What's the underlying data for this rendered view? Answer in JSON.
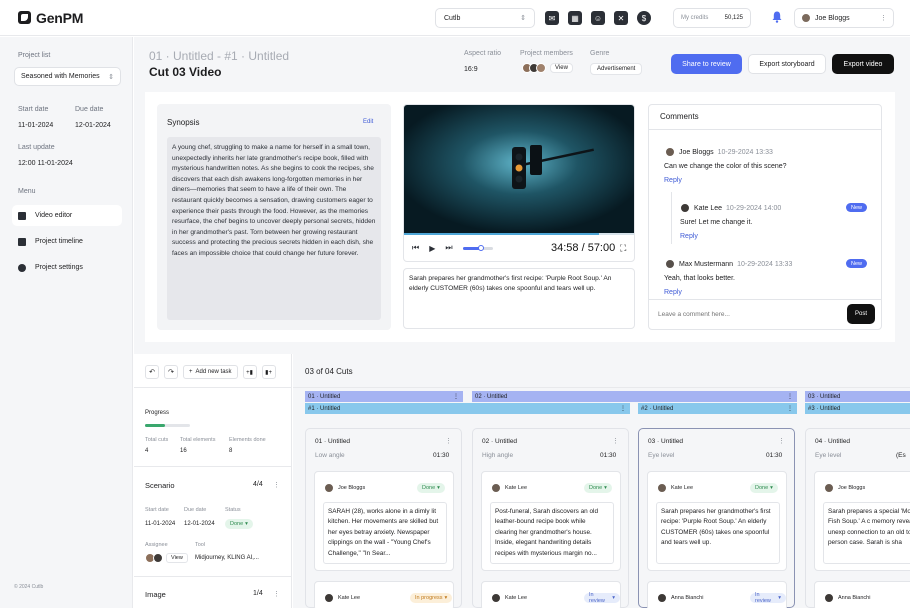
{
  "app": {
    "name": "GenPM"
  },
  "topbar": {
    "project_select": "Cutlb",
    "credits_label": "My credits",
    "credits_value": "50,125",
    "user_name": "Joe Bloggs",
    "icons": [
      "chat-icon",
      "calendar-icon",
      "team-icon",
      "tools-icon",
      "dollar-icon"
    ]
  },
  "sidebar": {
    "project_list_label": "Project list",
    "project_selected": "Seasoned with Memories",
    "start_date_label": "Start date",
    "start_date": "11-01-2024",
    "due_date_label": "Due date",
    "due_date": "12-01-2024",
    "last_update_label": "Last update",
    "last_update": "12:00 11-01-2024",
    "menu_label": "Menu",
    "menu": [
      {
        "label": "Video editor",
        "icon": "video-icon",
        "active": true
      },
      {
        "label": "Project timeline",
        "icon": "timeline-icon",
        "active": false
      },
      {
        "label": "Project settings",
        "icon": "gear-icon",
        "active": false
      }
    ],
    "footer": "© 2024 Cutlb"
  },
  "header": {
    "breadcrumb": "01 · Untitled - #1 · Untitled",
    "title": "Cut 03 Video",
    "aspect_label": "Aspect ratio",
    "aspect_value": "16:9",
    "members_label": "Project members",
    "members_view": "View",
    "genre_label": "Genre",
    "genre_value": "Advertisement",
    "share_btn": "Share to review",
    "export_storyboard_btn": "Export storyboard",
    "export_video_btn": "Export video"
  },
  "synopsis": {
    "title": "Synopsis",
    "edit": "Edit",
    "text": "A young chef, struggling to make a name for herself in a small town, unexpectedly inherits her late grandmother's recipe book, filled with mysterious handwritten notes. As she begins to cook the recipes, she discovers that each dish awakens long-forgotten memories in her diners—memories that seem to have a life of their own. The restaurant quickly becomes a sensation, drawing customers eager to experience their pasts through the food. However, as the memories resurface, the chef begins to uncover deeply personal secrets, hidden in her grandmother's past. Torn between her growing restaurant success and protecting the precious secrets hidden in each dish, she faces an impossible choice that could change her future forever."
  },
  "player": {
    "time": "34:58 / 57:00",
    "progress": 0.84,
    "volume": 0.6,
    "caption": "Sarah prepares her grandmother's first recipe: 'Purple Root Soup.' An elderly CUSTOMER (60s) takes one spoonful and tears well up."
  },
  "comments": {
    "title": "Comments",
    "items": [
      {
        "name": "Joe Bloggs",
        "date": "10-29-2024 13:33",
        "text": "Can we change the color of this scene?",
        "reply": "Reply",
        "new": false,
        "indent": false
      },
      {
        "name": "Kate Lee",
        "date": "10-29-2024 14:00",
        "text": "Sure! Let me change it.",
        "reply": "Reply",
        "new": true,
        "indent": true
      },
      {
        "name": "Max Mustermann",
        "date": "10-29-2024 13:33",
        "text": "Yeah, that looks better.",
        "reply": "Reply",
        "new": true,
        "indent": false
      }
    ],
    "new_label": "New",
    "input_placeholder": "Leave a comment here...",
    "post_btn": "Post"
  },
  "tasks": {
    "add_task": "Add new task",
    "progress_label": "Progress",
    "progress": 0.45,
    "total_cuts_label": "Total cuts",
    "total_cuts": "4",
    "total_elements_label": "Total elements",
    "total_elements": "16",
    "elements_done_label": "Elements done",
    "elements_done": "8",
    "scenario_label": "Scenario",
    "scenario_count": "4/4",
    "start_date_label": "Start date",
    "start_date": "11-01-2024",
    "due_date_label": "Due date",
    "due_date": "12-01-2024",
    "status_label": "Status",
    "status": "Done",
    "assignee_label": "Assignee",
    "assignee_view": "View",
    "tool_label": "Tool",
    "tool": "Midjourney, KLING AI,...",
    "image_label": "Image",
    "image_count": "1/4"
  },
  "cuts": {
    "title": "03 of 04 Cuts",
    "scene_headers": [
      {
        "label": "01 · Untitled",
        "sub": "#1 · Untitled"
      },
      {
        "label": "02 · Untitled",
        "sub": "#2 · Untitled"
      },
      {
        "label": "03 · Untitled",
        "sub": "#3 · Untitled"
      }
    ],
    "columns": [
      {
        "title": "01 · Untitled",
        "angle": "Low angle",
        "duration": "01:30",
        "assignee": "Joe Bloggs",
        "status": "Done",
        "status_type": "done",
        "text": "SARAH (28), works alone in a dimly lit kitchen. Her movements are skilled but her eyes betray anxiety. Newspaper clippings on the wall - \"Young Chef's Challenge,\" \"In Sear...",
        "next_assignee": "Kate Lee",
        "next_status": "In progress",
        "next_type": "prog",
        "selected": false
      },
      {
        "title": "02 · Untitled",
        "angle": "High angle",
        "duration": "01:30",
        "assignee": "Kate Lee",
        "status": "Done",
        "status_type": "done",
        "text": "Post-funeral, Sarah discovers an old leather-bound recipe book while clearing her grandmother's house. Inside, elegant handwriting details recipes with mysterious margin no...",
        "next_assignee": "Kate Lee",
        "next_status": "In review",
        "next_type": "review",
        "selected": false
      },
      {
        "title": "03 · Untitled",
        "angle": "Eye level",
        "duration": "01:30",
        "assignee": "Kate Lee",
        "status": "Done",
        "status_type": "done",
        "text": "Sarah prepares her grandmother's first recipe: 'Purple Root Soup.' An elderly CUSTOMER (60s) takes one spoonful and tears well up.",
        "next_assignee": "Anna Bianchi",
        "next_status": "In review",
        "next_type": "review",
        "selected": true
      },
      {
        "title": "04 · Untitled",
        "angle": "Eye level",
        "duration": "(Es",
        "assignee": "Joe Bloggs",
        "status": "",
        "status_type": "",
        "text": "Sarah prepares a special 'Moonlight Fish Soup.' A c memory reveals an unexp connection to an old tow person case. Sarah is sha",
        "next_assignee": "Anna Bianchi",
        "next_status": "",
        "next_type": "",
        "selected": false
      }
    ]
  },
  "colors": {
    "accent": "#4f6cf0",
    "scene_bar_1": "#a5b3f2",
    "scene_bar_2": "#88c8ec",
    "done": "#2e8b4f"
  }
}
